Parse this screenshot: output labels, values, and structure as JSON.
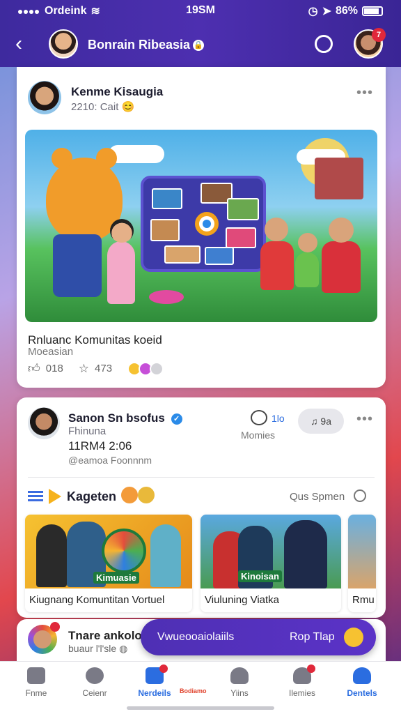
{
  "status_bar": {
    "carrier": "Ordeink",
    "time": "19SM",
    "battery": "86%"
  },
  "header": {
    "title": "Bonrain Ribeasia",
    "verified_glyph": "🔒",
    "notification_count": "7"
  },
  "post1": {
    "author": "Kenme Kisaugia",
    "meta": "2210: Cait",
    "title": "Rnluanc Komunitas koeid",
    "subtitle": "Moeasian",
    "likes": "018",
    "stars": "473"
  },
  "post2": {
    "author": "Sanon Sn bsofus",
    "subtitle": "Fhinuna",
    "date": "11RM4 2:06",
    "handle": "@eamoa Foonnnm",
    "comments_count": "1lo",
    "comments_label": "Momies",
    "pill_label": "9a",
    "section_title": "Kageten",
    "see_all": "Qus Spmen",
    "videos": [
      {
        "label": "Kiugnang Komuntitan Vortuel",
        "tag": "Kimuasie"
      },
      {
        "label": "Viuluning Viatka",
        "tag": "Kinoisan"
      },
      {
        "label": "Rmu"
      }
    ]
  },
  "post3": {
    "author": "Tnare ankolor",
    "meta": "buaur l'l'sle"
  },
  "cta": {
    "left": "Vwueooaiolaiils",
    "right": "Rop Tlap"
  },
  "bottom_nav": {
    "tabs": [
      {
        "label": "Fnme"
      },
      {
        "label": "Ceienr"
      },
      {
        "label": "Nerdeils"
      },
      {
        "label": "Yiins"
      },
      {
        "label": "Ilemies"
      },
      {
        "label": "Dentels"
      }
    ],
    "trend_label": "Bodiamo"
  },
  "colors": {
    "brand": "#4d2fb0",
    "accent": "#2b6de0",
    "badge": "#e0283a"
  }
}
